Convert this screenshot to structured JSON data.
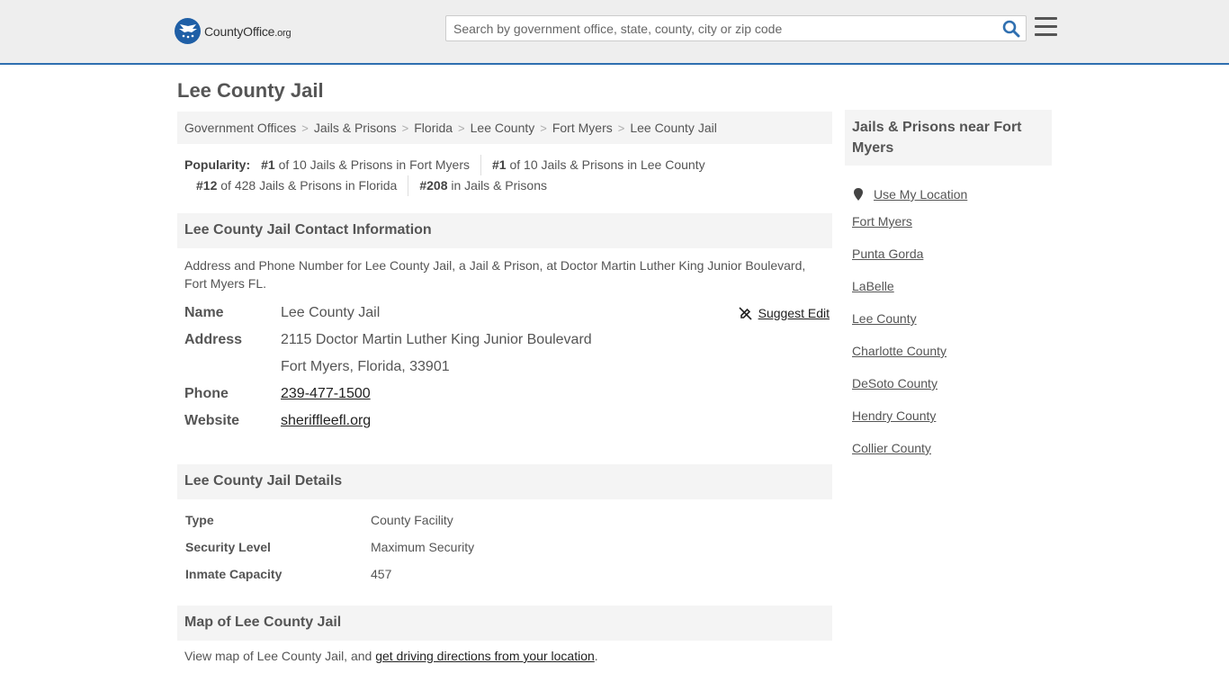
{
  "header": {
    "logo_text_main": "CountyOffice",
    "logo_text_domain": ".org",
    "search_placeholder": "Search by government office, state, county, city or zip code"
  },
  "page_title": "Lee County Jail",
  "breadcrumb": [
    "Government Offices",
    "Jails & Prisons",
    "Florida",
    "Lee County",
    "Fort Myers",
    "Lee County Jail"
  ],
  "popularity": {
    "label": "Popularity:",
    "items": [
      {
        "rank": "#1",
        "text": "of 10 Jails & Prisons in Fort Myers"
      },
      {
        "rank": "#1",
        "text": "of 10 Jails & Prisons in Lee County"
      },
      {
        "rank": "#12",
        "text": "of 428 Jails & Prisons in Florida"
      },
      {
        "rank": "#208",
        "text": "in Jails & Prisons"
      }
    ]
  },
  "contact": {
    "heading": "Lee County Jail Contact Information",
    "description": "Address and Phone Number for Lee County Jail, a Jail & Prison, at Doctor Martin Luther King Junior Boulevard, Fort Myers FL.",
    "suggest_edit": "Suggest Edit",
    "name_label": "Name",
    "name_value": "Lee County Jail",
    "address_label": "Address",
    "address_line1": "2115 Doctor Martin Luther King Junior Boulevard",
    "address_line2": "Fort Myers, Florida, 33901",
    "phone_label": "Phone",
    "phone_value": "239-477-1500",
    "website_label": "Website",
    "website_value": "sheriffleefl.org"
  },
  "details": {
    "heading": "Lee County Jail Details",
    "rows": [
      {
        "label": "Type",
        "value": "County Facility"
      },
      {
        "label": "Security Level",
        "value": "Maximum Security"
      },
      {
        "label": "Inmate Capacity",
        "value": "457"
      }
    ]
  },
  "map": {
    "heading": "Map of Lee County Jail",
    "text": "View map of Lee County Jail, and ",
    "link": "get driving directions from your location",
    "end": "."
  },
  "sidebar": {
    "heading": "Jails & Prisons near Fort Myers",
    "use_location": "Use My Location",
    "links": [
      "Fort Myers",
      "Punta Gorda",
      "LaBelle",
      "Lee County",
      "Charlotte County",
      "DeSoto County",
      "Hendry County",
      "Collier County"
    ]
  },
  "colors": {
    "accent": "#2f6fb0",
    "logo_blue": "#1f5fa6",
    "panel_bg": "#f4f4f4",
    "header_bg": "#eeeeee"
  }
}
